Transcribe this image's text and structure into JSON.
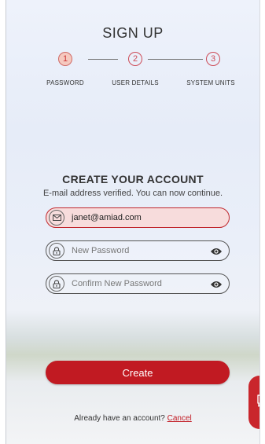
{
  "header": {
    "title": "SIGN UP"
  },
  "steps": [
    {
      "number": "1",
      "label": "PASSWORD",
      "active": true
    },
    {
      "number": "2",
      "label": "USER DETAILS",
      "active": false
    },
    {
      "number": "3",
      "label": "SYSTEM UNITS",
      "active": false
    }
  ],
  "form": {
    "heading": "CREATE YOUR ACCOUNT",
    "subheading": "E-mail address verified. You can now continue.",
    "email": {
      "value": "janet@amiad.com",
      "icon": "envelope-icon"
    },
    "new_password": {
      "placeholder": "New Password",
      "icon": "lock-icon"
    },
    "confirm_password": {
      "placeholder": "Confirm New Password",
      "icon": "lock-icon"
    },
    "submit_label": "Create"
  },
  "footer": {
    "prompt": "Already have an account?",
    "link_label": "Cancel"
  },
  "colors": {
    "accent": "#c11a22",
    "step_active_fill": "#f5c9bf",
    "field_filled_fill": "#f7dcdc"
  },
  "chat": {
    "icon": "chat-bubble-icon"
  }
}
